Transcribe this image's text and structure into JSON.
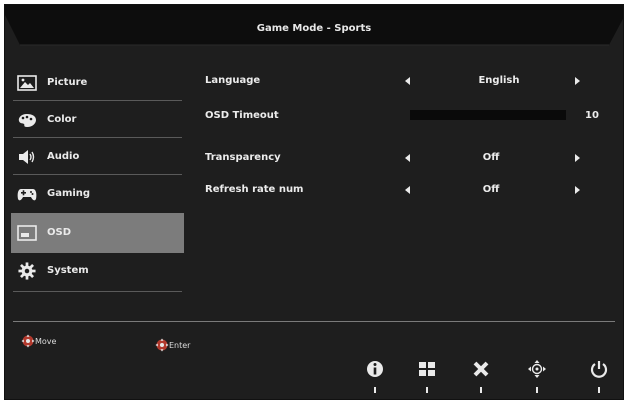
{
  "header": {
    "title": "Game Mode - Sports"
  },
  "sidebar": {
    "items": [
      {
        "label": "Picture",
        "icon": "picture-icon",
        "active": false
      },
      {
        "label": "Color",
        "icon": "palette-icon",
        "active": false
      },
      {
        "label": "Audio",
        "icon": "speaker-icon",
        "active": false
      },
      {
        "label": "Gaming",
        "icon": "gamepad-icon",
        "active": false
      },
      {
        "label": "OSD",
        "icon": "osd-window-icon",
        "active": true
      },
      {
        "label": "System",
        "icon": "gear-icon",
        "active": false
      }
    ]
  },
  "settings": {
    "language": {
      "label": "Language",
      "value": "English"
    },
    "osd_timeout": {
      "label": "OSD Timeout",
      "value": "10"
    },
    "transparency": {
      "label": "Transparency",
      "value": "Off"
    },
    "refresh_rate_num": {
      "label": "Refresh rate num",
      "value": "Off"
    }
  },
  "hints": {
    "move": "Move",
    "enter": "Enter"
  },
  "keys": [
    "info-icon",
    "windows-grid-icon",
    "close-icon",
    "move-dpad-icon",
    "power-icon"
  ],
  "colors": {
    "background": "#1e1e1e",
    "header": "#0e0e0e",
    "active_item": "#7c7c7c",
    "dpad_accent": "#c0392b"
  }
}
